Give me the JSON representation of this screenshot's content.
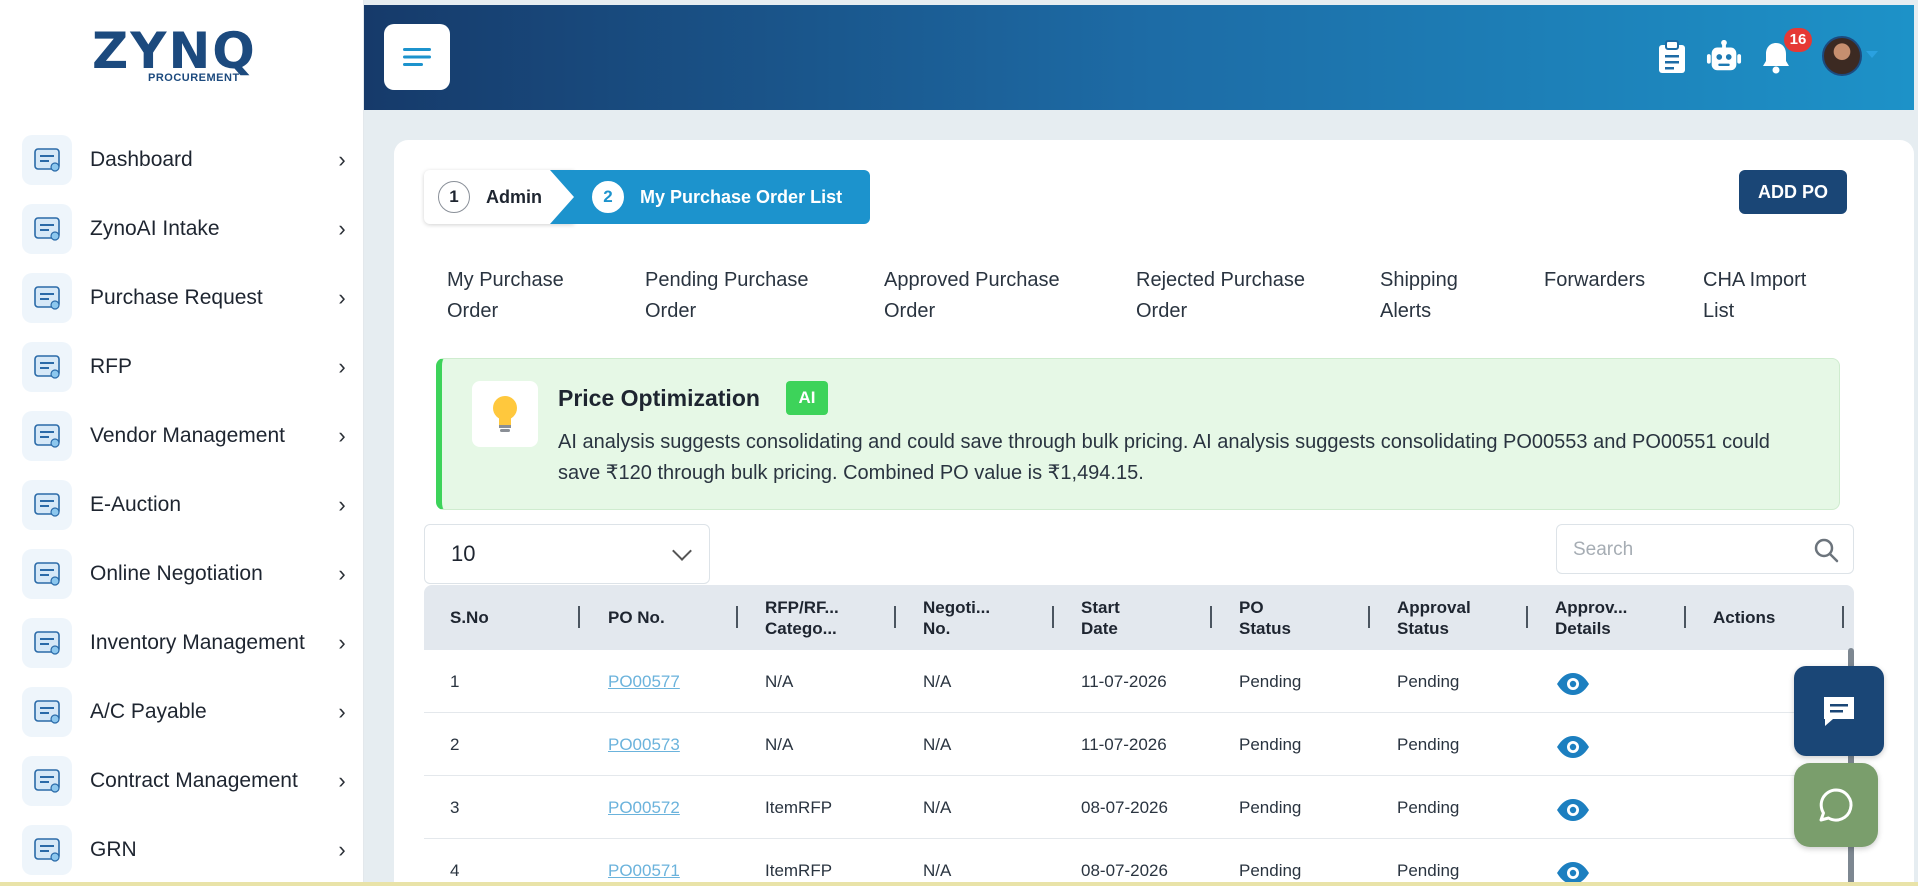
{
  "brand": {
    "name": "ZYNQ",
    "sub": "PROCUREMENT"
  },
  "sidebar": {
    "items": [
      {
        "label": "Dashboard",
        "icon": "dashboard-icon"
      },
      {
        "label": "ZynoAI Intake",
        "icon": "ai-intake-icon"
      },
      {
        "label": "Purchase Request",
        "icon": "purchase-request-icon"
      },
      {
        "label": "RFP",
        "icon": "rfp-icon"
      },
      {
        "label": "Vendor Management",
        "icon": "vendor-icon"
      },
      {
        "label": "E-Auction",
        "icon": "auction-icon"
      },
      {
        "label": "Online Negotiation",
        "icon": "negotiation-icon"
      },
      {
        "label": "Inventory Management",
        "icon": "inventory-icon"
      },
      {
        "label": "A/C Payable",
        "icon": "payable-icon"
      },
      {
        "label": "Contract Management",
        "icon": "contract-icon"
      },
      {
        "label": "GRN",
        "icon": "grn-icon"
      }
    ]
  },
  "header": {
    "notification_count": "16"
  },
  "stepper": [
    {
      "num": "1",
      "label": "Admin"
    },
    {
      "num": "2",
      "label": "My Purchase Order List"
    }
  ],
  "add_po_label": "ADD PO",
  "tabs": [
    {
      "line1": "My Purchase",
      "line2": "Order"
    },
    {
      "line1": "Pending Purchase",
      "line2": "Order"
    },
    {
      "line1": "Approved Purchase",
      "line2": "Order"
    },
    {
      "line1": "Rejected Purchase",
      "line2": "Order"
    },
    {
      "line1": "Shipping",
      "line2": "Alerts"
    },
    {
      "line1": "Forwarders",
      "line2": ""
    },
    {
      "line1": "CHA Import",
      "line2": "List"
    }
  ],
  "ai_box": {
    "title": "Price Optimization",
    "tag": "AI",
    "text": "AI analysis suggests consolidating and could save through bulk pricing. AI analysis suggests consolidating PO00553 and PO00551 could save ₹120 through bulk pricing. Combined PO value is ₹1,494.15."
  },
  "page_size": "10",
  "search": {
    "placeholder": "Search"
  },
  "table": {
    "headers": [
      {
        "line1": "S.No",
        "line2": ""
      },
      {
        "line1": "PO No.",
        "line2": ""
      },
      {
        "line1": "RFP/RF...",
        "line2": "Catego..."
      },
      {
        "line1": "Negoti...",
        "line2": "No."
      },
      {
        "line1": "Start",
        "line2": "Date"
      },
      {
        "line1": "PO",
        "line2": "Status"
      },
      {
        "line1": "Approval",
        "line2": "Status"
      },
      {
        "line1": "Approv...",
        "line2": "Details"
      },
      {
        "line1": "Actions",
        "line2": ""
      }
    ],
    "rows": [
      {
        "sno": "1",
        "po": "PO00577",
        "category": "N/A",
        "negotiation": "N/A",
        "start_date": "11-07-2026",
        "po_status": "Pending",
        "approval_status": "Pending"
      },
      {
        "sno": "2",
        "po": "PO00573",
        "category": "N/A",
        "negotiation": "N/A",
        "start_date": "11-07-2026",
        "po_status": "Pending",
        "approval_status": "Pending"
      },
      {
        "sno": "3",
        "po": "PO00572",
        "category": "ItemRFP",
        "negotiation": "N/A",
        "start_date": "08-07-2026",
        "po_status": "Pending",
        "approval_status": "Pending"
      },
      {
        "sno": "4",
        "po": "PO00571",
        "category": "ItemRFP",
        "negotiation": "N/A",
        "start_date": "08-07-2026",
        "po_status": "Pending",
        "approval_status": "Pending"
      }
    ]
  },
  "colors": {
    "accent": "#1c93cd",
    "navy": "#1a4676",
    "ai_green": "#3dd35a",
    "badge": "#e53935"
  }
}
